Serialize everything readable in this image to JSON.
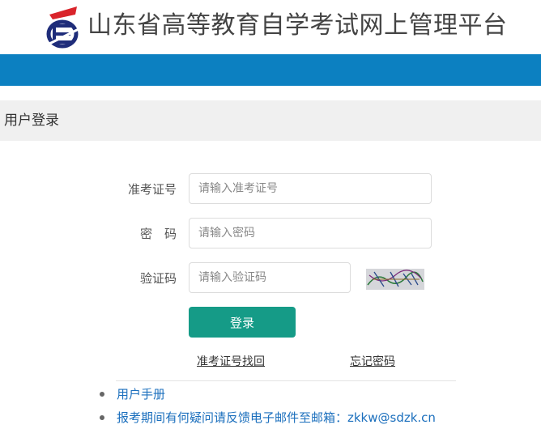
{
  "header": {
    "site_title": "山东省高等教育自学考试网上管理平台",
    "logo_icon": "education-exam-logo-icon"
  },
  "colors": {
    "brand_blue": "#0c80c1",
    "button_green": "#159b87",
    "logo_red": "#d9242b",
    "logo_navy": "#1f2d7a"
  },
  "login": {
    "section_title": "用户登录",
    "fields": [
      {
        "label": "准考证号",
        "placeholder": "请输入准考证号",
        "value": ""
      },
      {
        "label": "密　码",
        "placeholder": "请输入密码",
        "value": ""
      },
      {
        "label": "验证码",
        "placeholder": "请输入验证码",
        "value": ""
      }
    ],
    "captcha_icon": "captcha-image",
    "submit_label": "登录",
    "links": {
      "recover_id": "准考证号找回",
      "forgot_password": "忘记密码"
    }
  },
  "help": {
    "items": [
      "用户手册",
      "报考期间有何疑问请反馈电子邮件至邮箱：zkkw@sdzk.cn"
    ]
  }
}
